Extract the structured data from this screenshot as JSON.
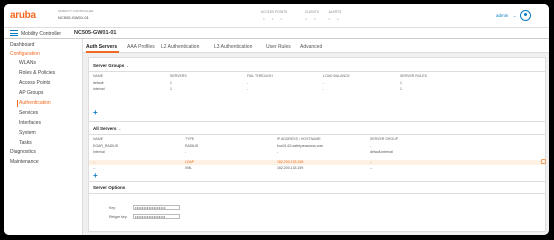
{
  "header": {
    "logo": "aruba",
    "controller_label": "MOBILITY CONTROLLER",
    "controller_name": "NC505-GW01-01",
    "stats": [
      {
        "label": "ACCESS POINTS",
        "dots": "● ● ●"
      },
      {
        "label": "CLIENTS",
        "dots": "● ●"
      },
      {
        "label": "ALERTS",
        "dots": "● ●"
      }
    ],
    "user": "admin"
  },
  "subbar": {
    "controller_label": "Mobility Controller",
    "controller_name": "NC505-GW01-01"
  },
  "sidebar": {
    "items": [
      {
        "label": "Dashboard",
        "level": "top"
      },
      {
        "label": "Configuration",
        "level": "top",
        "active": true
      },
      {
        "label": "WLANs",
        "level": "sub"
      },
      {
        "label": "Roles & Policies",
        "level": "sub"
      },
      {
        "label": "Access Points",
        "level": "sub"
      },
      {
        "label": "AP Groups",
        "level": "sub"
      },
      {
        "label": "Authentication",
        "level": "sub",
        "active": true
      },
      {
        "label": "Services",
        "level": "sub"
      },
      {
        "label": "Interfaces",
        "level": "sub"
      },
      {
        "label": "System",
        "level": "sub"
      },
      {
        "label": "Tasks",
        "level": "sub"
      },
      {
        "label": "Diagnostics",
        "level": "top"
      },
      {
        "label": "Maintenance",
        "level": "top"
      }
    ]
  },
  "tabs": [
    {
      "label": "Auth Servers",
      "active": true
    },
    {
      "label": "AAA Profiles"
    },
    {
      "label": "L2 Authentication"
    },
    {
      "label": "L3 Authentication"
    },
    {
      "label": "User Rules"
    },
    {
      "label": "Advanced"
    }
  ],
  "server_groups": {
    "title": "Server Groups",
    "caret": "⌄",
    "columns": [
      "NAME",
      "SERVERS",
      "FAIL THROUGH",
      "LOAD BALANCE",
      "SERVER RULES"
    ],
    "rows": [
      [
        "default",
        "1",
        "-",
        "-",
        "1"
      ],
      [
        "internal",
        "1",
        "-",
        "-",
        "1"
      ]
    ],
    "add": "+"
  },
  "all_servers": {
    "title": "All Servers",
    "caret": "⌄",
    "columns": [
      "NAME",
      "TYPE",
      "IP ADDRESS / HOSTNAME",
      "SERVER GROUP"
    ],
    "rows": [
      [
        "EGAR_RADIUS",
        "RADIUS",
        "box01.62.safetyreaccess.com",
        "-"
      ],
      [
        "Internal",
        "-",
        "-",
        "default,internal"
      ],
      [
        "--",
        "LDAP",
        "162.200.133.158",
        "--"
      ],
      [
        "--",
        "XML",
        "162.200.133.159",
        "--"
      ]
    ],
    "selected_row": 2,
    "add": "+"
  },
  "server_options": {
    "title": "Server Options",
    "key_label": "Key:",
    "key_value": "••••••••••••••••••",
    "retype_label": "Retype key:",
    "retype_value": "••••••••••••••••••"
  },
  "colors": {
    "accent": "#f26a21",
    "link": "#0a7ec2"
  }
}
